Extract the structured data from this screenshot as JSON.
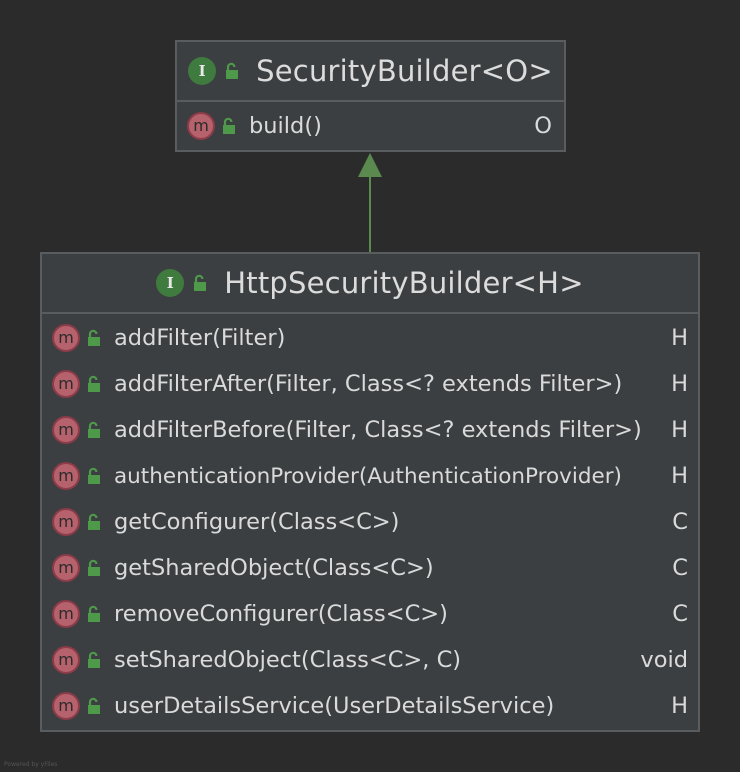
{
  "diagram": {
    "parent": {
      "kind_badge": "I",
      "name": "SecurityBuilder<O>",
      "methods": [
        {
          "badge": "m",
          "name": "build()",
          "return_type": "O"
        }
      ]
    },
    "child": {
      "kind_badge": "I",
      "name": "HttpSecurityBuilder<H>",
      "methods": [
        {
          "badge": "m",
          "name": "addFilter(Filter)",
          "return_type": "H"
        },
        {
          "badge": "m",
          "name": "addFilterAfter(Filter, Class<? extends Filter>)",
          "return_type": "H"
        },
        {
          "badge": "m",
          "name": "addFilterBefore(Filter, Class<? extends Filter>)",
          "return_type": "H"
        },
        {
          "badge": "m",
          "name": "authenticationProvider(AuthenticationProvider)",
          "return_type": "H"
        },
        {
          "badge": "m",
          "name": "getConfigurer(Class<C>)",
          "return_type": "C"
        },
        {
          "badge": "m",
          "name": "getSharedObject(Class<C>)",
          "return_type": "C"
        },
        {
          "badge": "m",
          "name": "removeConfigurer(Class<C>)",
          "return_type": "C"
        },
        {
          "badge": "m",
          "name": "setSharedObject(Class<C>, C)",
          "return_type": "void"
        },
        {
          "badge": "m",
          "name": "userDetailsService(UserDetailsService)",
          "return_type": "H"
        }
      ]
    },
    "relationship": "extends",
    "colors": {
      "background": "#2b2b2b",
      "box": "#3b3f41",
      "border": "#5a5d5f",
      "arrow": "#5b8a4f",
      "interface_badge": "#3f7b3e",
      "method_badge": "#b5626c"
    },
    "watermark": "Powered by yFiles"
  }
}
